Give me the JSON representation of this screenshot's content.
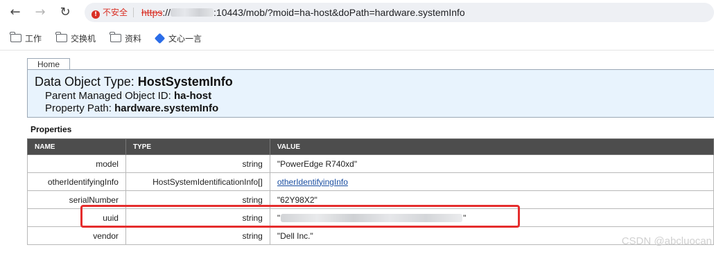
{
  "browser": {
    "security_label": "不安全",
    "url_scheme": "https",
    "url_sep": "://",
    "url_rest": ":10443/mob/?moid=ha-host&doPath=hardware.systemInfo"
  },
  "bookmarks": [
    {
      "label": "工作"
    },
    {
      "label": "交换机"
    },
    {
      "label": "资料"
    },
    {
      "label": "文心一言"
    }
  ],
  "page": {
    "home_tab": "Home",
    "header": {
      "title_prefix": "Data Object Type: ",
      "title_value": "HostSystemInfo",
      "parent_prefix": "Parent Managed Object ID: ",
      "parent_value": "ha-host",
      "path_prefix": "Property Path: ",
      "path_value": "hardware.systemInfo"
    },
    "properties_title": "Properties",
    "columns": [
      "NAME",
      "TYPE",
      "VALUE"
    ],
    "rows": [
      {
        "name": "model",
        "type": "string",
        "value": "\"PowerEdge R740xd\""
      },
      {
        "name": "otherIdentifyingInfo",
        "type": "HostSystemIdentificationInfo[]",
        "value": "otherIdentifyingInfo"
      },
      {
        "name": "serialNumber",
        "type": "string",
        "value": "\"62Y98X2\""
      },
      {
        "name": "uuid",
        "type": "string",
        "value_quote_open": "\"",
        "value_quote_close": "\""
      },
      {
        "name": "vendor",
        "type": "string",
        "value": "\"Dell Inc.\""
      }
    ]
  },
  "watermark": "CSDN @abcluocan",
  "colors": {
    "header_bg": "#e8f3fd",
    "table_header_bg": "#4d4d4d",
    "highlight_border": "#e52d2d",
    "insecure_red": "#d93025",
    "link": "#1a4ea1"
  }
}
